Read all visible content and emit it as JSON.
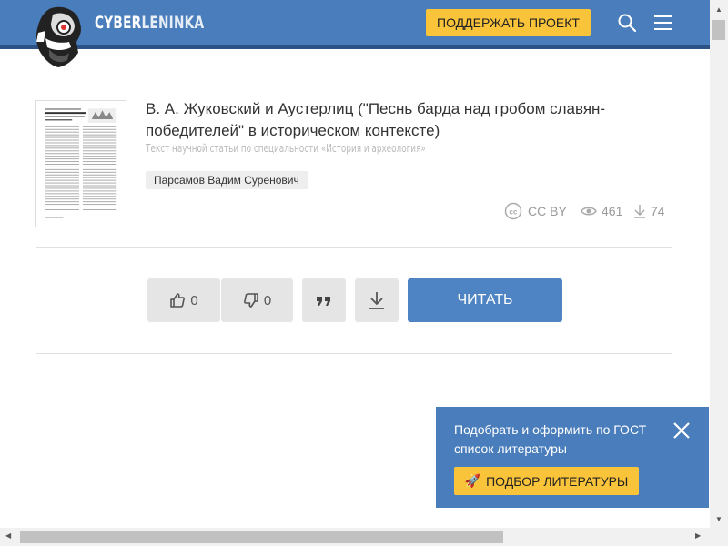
{
  "header": {
    "brand_part1": "CYBER",
    "brand_part2": "LENINKA",
    "support_button": "ПОДДЕРЖАТЬ ПРОЕКТ",
    "search_icon": "search-icon",
    "menu_icon": "hamburger-menu-icon",
    "background_color": "#4a7dbb",
    "button_color": "#f9c33a"
  },
  "article": {
    "title": "В. А. Жуковский и Аустерлиц (\"Песнь барда над гробом славян-победителей\" в историческом контексте)",
    "subtitle": "Текст научной статьи по специальности «История и археология»",
    "author": "Парсамов Вадим Суренович",
    "license": "CC BY",
    "views": "461",
    "downloads": "74"
  },
  "actions": {
    "likes": "0",
    "dislikes": "0",
    "read_button": "ЧИТАТЬ",
    "accent_color": "#4f84c4"
  },
  "popup": {
    "text": "Подобрать и оформить по ГОСТ список литературы",
    "button": "ПОДБОР ЛИТЕРАТУРЫ",
    "button_icon": "🚀"
  }
}
